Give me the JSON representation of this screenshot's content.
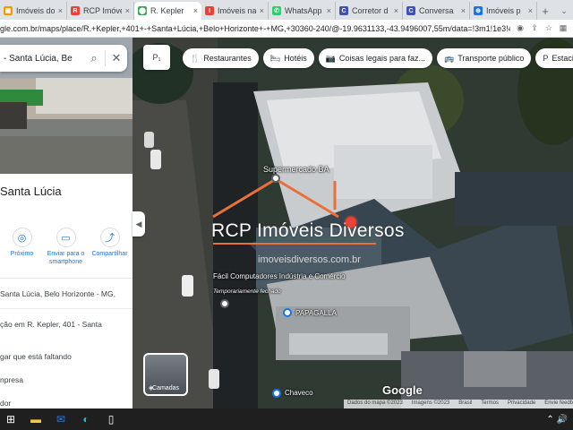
{
  "browser": {
    "tabs": [
      {
        "title": "Imóveis do",
        "fav_color": "#f29900",
        "fav_glyph": "▣",
        "active": false
      },
      {
        "title": "RCP Imóveis",
        "fav_color": "#ea4335",
        "fav_glyph": "R",
        "active": false
      },
      {
        "title": "R. Kepler",
        "fav_color": "#34a853",
        "fav_glyph": "⬤",
        "active": true
      },
      {
        "title": "Imóveis na",
        "fav_color": "#ea4335",
        "fav_glyph": "I",
        "active": false
      },
      {
        "title": "WhatsApp",
        "fav_color": "#25d366",
        "fav_glyph": "✆",
        "active": false
      },
      {
        "title": "Corretor d",
        "fav_color": "#3f51b5",
        "fav_glyph": "C",
        "active": false
      },
      {
        "title": "Conversa",
        "fav_color": "#3f51b5",
        "fav_glyph": "C",
        "active": false
      },
      {
        "title": "Imóveis p",
        "fav_color": "#1a73e8",
        "fav_glyph": "⊕",
        "active": false
      }
    ],
    "close_glyph": "×",
    "new_tab": "+",
    "tab_scroll": "⌄",
    "url": "gle.com.br/maps/place/R.+Kepler,+401+-+Santa+Lúcia,+Belo+Horizonte+-+MG,+30360-240/@-19.9631133,-43.9496007,55m/data=!3m1!1e3!4m6..."
  },
  "maps": {
    "search_query": "- Santa Lúcia, Be",
    "search_icon": "⌕",
    "close_icon": "✕",
    "place_title": "Santa Lúcia",
    "actions": [
      {
        "label": "Próximo",
        "glyph": "◎"
      },
      {
        "label": "Enviar para o smartphone",
        "glyph": "▭"
      },
      {
        "label": "Compartilhar",
        "glyph": "⤴"
      }
    ],
    "address": "Santa Lúcia, Belo Horizonte - MG,",
    "info_lines": [
      "ção em R. Kepler, 401 - Santa",
      "gar que está faltando",
      "npresa",
      "dor"
    ],
    "collapse_glyph": "◀",
    "chips": [
      {
        "icon": "🍴",
        "label": "Restaurantes"
      },
      {
        "icon": "🛏",
        "label": "Hotéis"
      },
      {
        "icon": "📷",
        "label": "Coisas legais para faz..."
      },
      {
        "icon": "🚌",
        "label": "Transporte público"
      },
      {
        "icon": "P",
        "label": "Estacion"
      }
    ],
    "map_button_label": "P₁",
    "layers_label": "Camadas",
    "google_logo": "Google",
    "attribution": [
      "Dados do mapa ©2023",
      "Imagens ©2023",
      "Brasil",
      "Termos",
      "Privacidade",
      "Envie feedb"
    ],
    "pois": [
      {
        "name": "Supermercado BA"
      },
      {
        "name": "Fácil Computadores Indústria e Comércio"
      },
      {
        "name": "Temporariamente fechado"
      },
      {
        "name": "PAPAGALLA"
      },
      {
        "name": "Chaveco"
      }
    ]
  },
  "watermark": {
    "text": "RCP Imóveis Diversos",
    "url": "imoveisdiversos.com.br",
    "color": "#e8703a"
  },
  "taskbar": {
    "icons": [
      "windows-icon",
      "file-explorer-icon",
      "mail-icon",
      "edge-icon",
      "document-icon"
    ],
    "tray": "⌃ 🔊"
  }
}
